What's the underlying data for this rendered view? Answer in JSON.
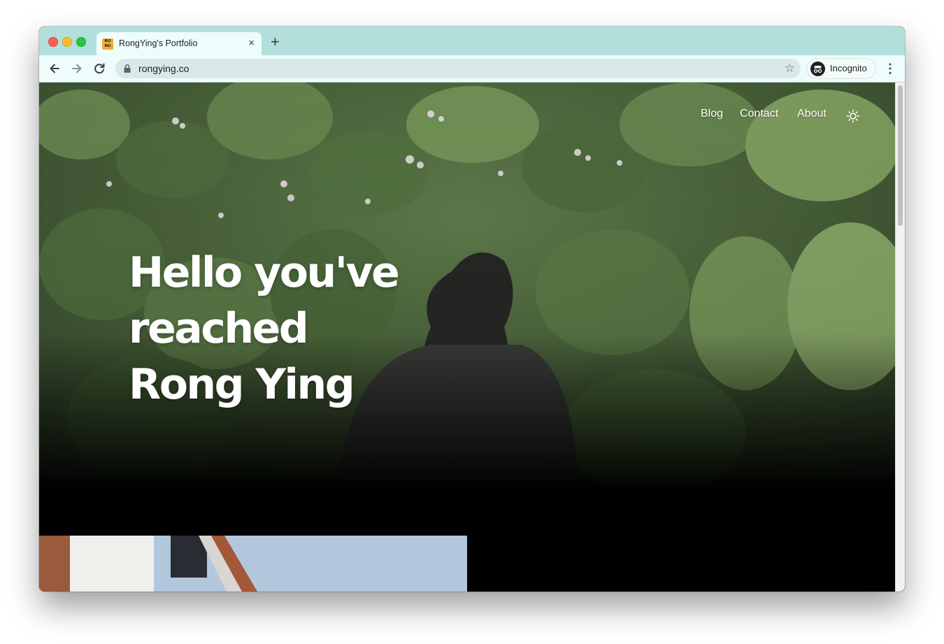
{
  "browser": {
    "tab": {
      "favicon_text": "RO NG",
      "title": "RongYing's Portfolio",
      "close_glyph": "×"
    },
    "new_tab_glyph": "+",
    "toolbar": {
      "back_icon": "arrow-left-icon",
      "forward_icon": "arrow-right-icon",
      "reload_icon": "reload-icon",
      "url": "rongying.co",
      "bookmark_glyph": "☆",
      "profile_label": "Incognito",
      "menu_glyph": "⋮"
    },
    "colors": {
      "tabstrip": "#b2dfdb",
      "toolbar": "#eefdfc"
    }
  },
  "site": {
    "nav": {
      "items": [
        {
          "label": "Blog"
        },
        {
          "label": "Contact"
        },
        {
          "label": "About"
        }
      ],
      "theme_toggle_icon": "sun-icon"
    },
    "hero": {
      "headline_lines": [
        "Hello you've",
        "reached",
        "Rong Ying"
      ]
    }
  }
}
